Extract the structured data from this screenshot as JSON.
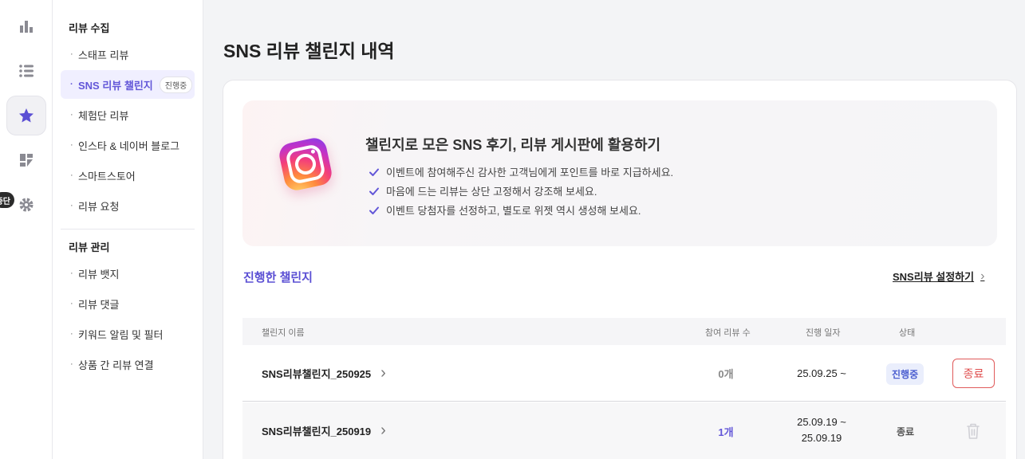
{
  "rail": {
    "items": [
      {
        "icon": "bar-chart-icon"
      },
      {
        "icon": "list-icon"
      },
      {
        "icon": "star-icon",
        "active": true
      },
      {
        "icon": "dashboard-icon"
      },
      {
        "icon": "gear-icon"
      }
    ],
    "tag_label": "중단"
  },
  "sidebar": {
    "group1_title": "리뷰 수집",
    "group1_items": [
      {
        "label": "스태프 리뷰"
      },
      {
        "label": "SNS 리뷰 챌린지",
        "badge": "진행중",
        "active": true
      },
      {
        "label": "체험단 리뷰"
      },
      {
        "label": "인스타 & 네이버 블로그"
      },
      {
        "label": "스마트스토어"
      },
      {
        "label": "리뷰 요청"
      }
    ],
    "group2_title": "리뷰 관리",
    "group2_items": [
      {
        "label": "리뷰 뱃지"
      },
      {
        "label": "리뷰 댓글"
      },
      {
        "label": "키워드 알림 및 필터"
      },
      {
        "label": "상품 간 리뷰 연결"
      }
    ],
    "bullet": "·"
  },
  "main": {
    "title": "SNS 리뷰 챌린지 내역",
    "banner": {
      "title": "챌린지로 모은 SNS 후기, 리뷰 게시판에 활용하기",
      "points": [
        "이벤트에 참여해주신 감사한 고객님에게 포인트를 바로 지급하세요.",
        "마음에 드는 리뷰는 상단 고정해서 강조해 보세요.",
        "이벤트 당첨자를 선정하고, 별도로 위젯 역시 생성해 보세요."
      ]
    },
    "section_title": "진행한 챌린지",
    "setting_link": "SNS리뷰 설정하기",
    "table": {
      "headers": {
        "name": "챌린지 이름",
        "count": "참여 리뷰 수",
        "date": "진행 일자",
        "status": "상태"
      },
      "rows": [
        {
          "name": "SNS리뷰챌린지_250925",
          "count": "0개",
          "date_start": "25.09.25 ~",
          "date_end": "",
          "status": "진행중",
          "action": "종료"
        },
        {
          "name": "SNS리뷰챌린지_250919",
          "count": "1개",
          "date_start": "25.09.19 ~",
          "date_end": "25.09.19",
          "status": "종료",
          "action_icon": "trash-icon"
        }
      ]
    }
  },
  "colors": {
    "accent": "#5b4fd4",
    "danger": "#e05050",
    "status_on": "#4c5fd0"
  }
}
